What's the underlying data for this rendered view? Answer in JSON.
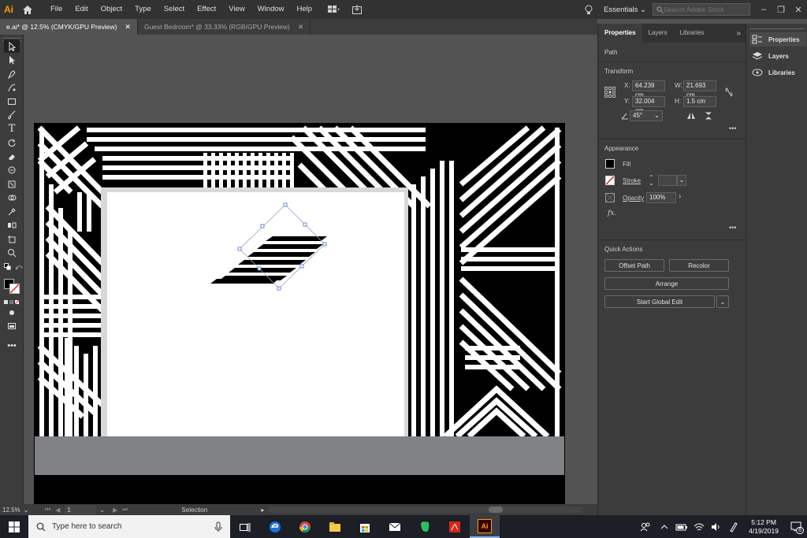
{
  "app": {
    "logo": "Ai"
  },
  "menu": [
    "File",
    "Edit",
    "Object",
    "Type",
    "Select",
    "Effect",
    "View",
    "Window",
    "Help"
  ],
  "workspace": {
    "label": "Essentials"
  },
  "stock_search": {
    "placeholder": "Search Adobe Stock"
  },
  "tabs": [
    {
      "label": "e.ai* @ 12.5% (CMYK/GPU Preview)",
      "active": true
    },
    {
      "label": "Guest Bedroom* @ 33.33% (RGB/GPU Preview)",
      "active": false
    }
  ],
  "panel": {
    "tabs": [
      "Properties",
      "Layers",
      "Libraries"
    ],
    "selection_type": "Path",
    "transform": {
      "title": "Transform",
      "x_label": "X:",
      "x": "64.239 cm",
      "y_label": "Y:",
      "y": "32.004 cm",
      "w_label": "W:",
      "w": "21.693 cm",
      "h_label": "H:",
      "h": "1.5 cm",
      "angle": "45°"
    },
    "appearance": {
      "title": "Appearance",
      "fill_label": "Fill",
      "stroke_label": "Stroke",
      "opacity_label": "Opacity",
      "opacity": "100%",
      "fx_label": "fx."
    },
    "quick_actions": {
      "title": "Quick Actions",
      "offset_path": "Offset Path",
      "recolor": "Recolor",
      "arrange": "Arrange",
      "start_global_edit": "Start Global Edit"
    }
  },
  "dock": [
    "Properties",
    "Layers",
    "Libraries"
  ],
  "status": {
    "zoom": "12.5%",
    "artboard": "1",
    "tool": "Selection"
  },
  "taskbar": {
    "search_placeholder": "Type here to search",
    "time": "5:12 PM",
    "date": "4/19/2019",
    "notifications": "6"
  },
  "colors": {
    "accent_ai": "#ff9a00",
    "selection": "#4a6fd8",
    "ui_dark": "#323232",
    "ui_panel": "#3c3c3c",
    "canvas": "#535353"
  }
}
